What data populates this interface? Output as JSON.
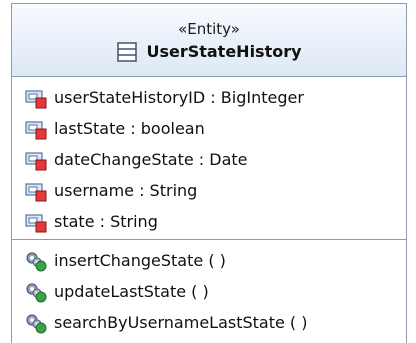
{
  "entity": {
    "stereotype": "«Entity»",
    "name": "UserStateHistory",
    "class_icon": "class-icon"
  },
  "attributes": [
    {
      "text": "userStateHistoryID : BigInteger",
      "icon": "private-field-icon"
    },
    {
      "text": "lastState : boolean",
      "icon": "private-field-icon"
    },
    {
      "text": "dateChangeState : Date",
      "icon": "private-field-icon"
    },
    {
      "text": "username : String",
      "icon": "private-field-icon"
    },
    {
      "text": "state : String",
      "icon": "private-field-icon"
    }
  ],
  "operations": [
    {
      "text": "insertChangeState ( )",
      "icon": "public-operation-icon"
    },
    {
      "text": "updateLastState ( )",
      "icon": "public-operation-icon"
    },
    {
      "text": "searchByUsernameLastState ( )",
      "icon": "public-operation-icon"
    }
  ],
  "colors": {
    "border": "#8f9bb0",
    "header_top": "#f8fafe",
    "header_bottom": "#dde8f6",
    "private_marker": "#e23a3a",
    "public_marker": "#3aa34a"
  }
}
